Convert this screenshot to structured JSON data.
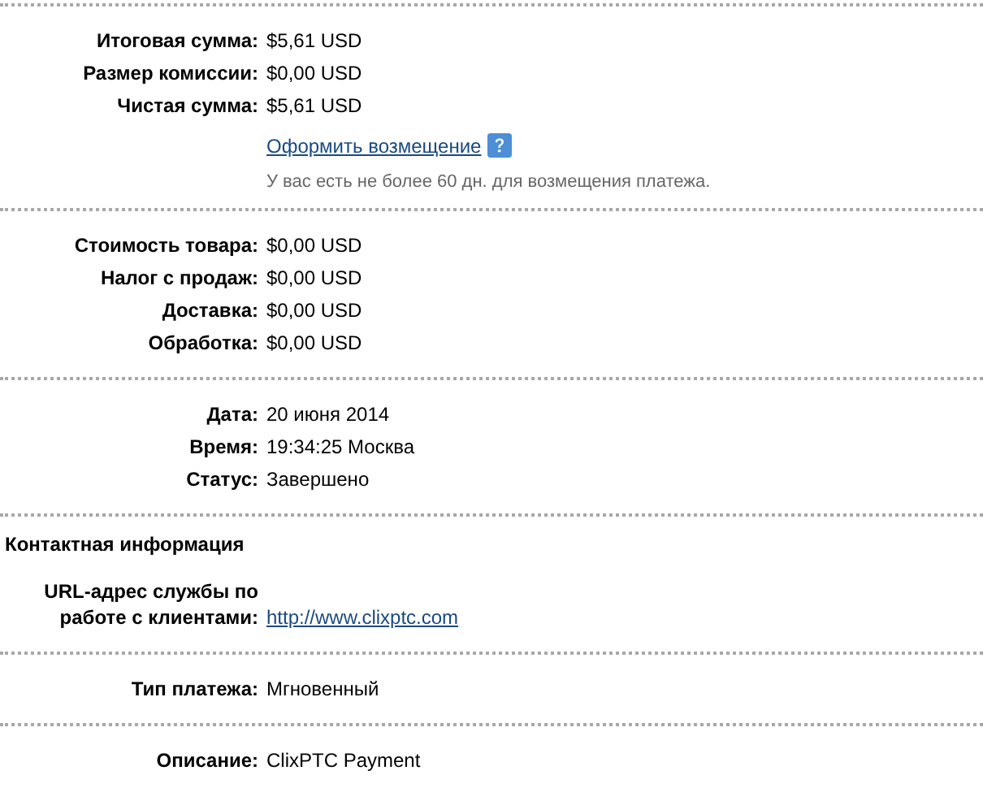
{
  "sections": [
    {
      "rows": [
        {
          "kind": "text",
          "label": "Итоговая сумма:",
          "value": "$5,61 USD"
        },
        {
          "kind": "text",
          "label": "Размер комиссии:",
          "value": "$0,00 USD"
        },
        {
          "kind": "text",
          "label": "Чистая сумма:",
          "value": "$5,61 USD"
        }
      ],
      "refund": {
        "link": "Оформить возмещение",
        "note": "У вас есть не более 60 дн. для возмещения платежа."
      }
    },
    {
      "rows": [
        {
          "kind": "text",
          "label": "Стоимость товара:",
          "value": "$0,00 USD"
        },
        {
          "kind": "text",
          "label": "Налог с продаж:",
          "value": "$0,00 USD"
        },
        {
          "kind": "text",
          "label": "Доставка:",
          "value": "$0,00 USD"
        },
        {
          "kind": "text",
          "label": "Обработка:",
          "value": "$0,00 USD"
        }
      ]
    },
    {
      "rows": [
        {
          "kind": "text",
          "label": "Дата:",
          "value": "20 июня 2014"
        },
        {
          "kind": "text",
          "label": "Время:",
          "value": "19:34:25 Москва"
        },
        {
          "kind": "text",
          "label": "Статус:",
          "value": "Завершено"
        }
      ]
    },
    {
      "title": "Контактная информация",
      "rows": [
        {
          "kind": "link",
          "label": "URL-адрес службы по работе с клиентами:",
          "value": "http://www.clixptc.com"
        }
      ]
    },
    {
      "rows": [
        {
          "kind": "text",
          "label": "Тип платежа:",
          "value": "Мгновенный"
        }
      ]
    },
    {
      "rows": [
        {
          "kind": "text",
          "label": "Описание:",
          "value": "ClixPTC Payment"
        }
      ]
    }
  ]
}
